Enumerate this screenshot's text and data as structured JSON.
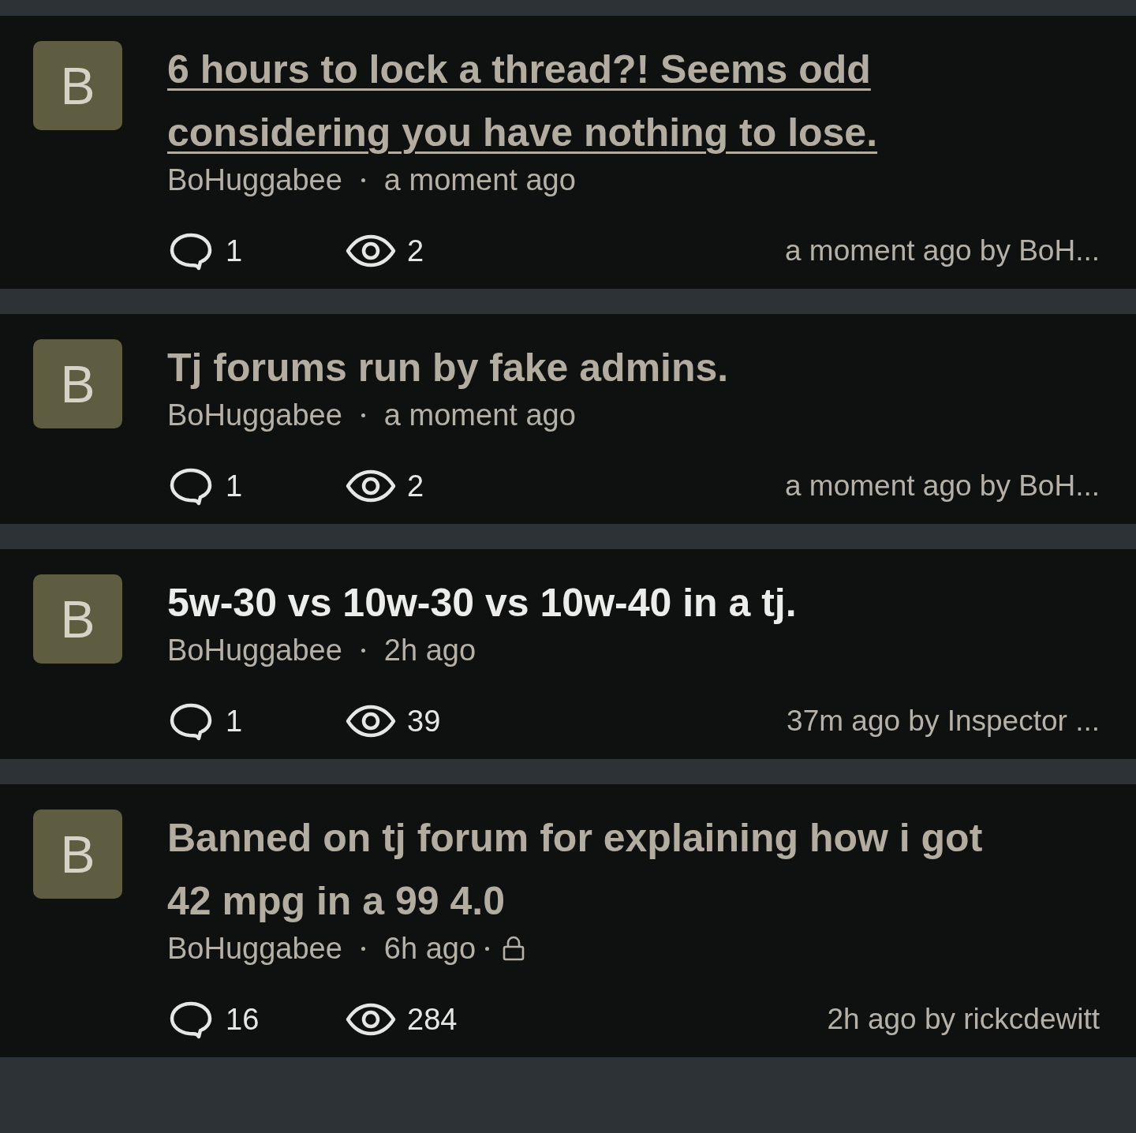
{
  "topics": [
    {
      "avatar": {
        "letter": "B",
        "color": "#5e5d41"
      },
      "title": "6 hours to lock a thread?! Seems odd considering you have nothing to lose.",
      "visited": true,
      "hovered": true,
      "author": "BoHuggabee",
      "time": "a moment ago",
      "locked": false,
      "replies": "1",
      "views": "2",
      "last_activity": "a moment ago by BoH..."
    },
    {
      "avatar": {
        "letter": "B",
        "color": "#5e5d41"
      },
      "title": "Tj forums run by fake admins.",
      "visited": true,
      "hovered": false,
      "author": "BoHuggabee",
      "time": "a moment ago",
      "locked": false,
      "replies": "1",
      "views": "2",
      "last_activity": "a moment ago by BoH..."
    },
    {
      "avatar": {
        "letter": "B",
        "color": "#5e5d41"
      },
      "title": "5w-30 vs 10w-30 vs 10w-40 in a tj.",
      "visited": false,
      "hovered": false,
      "author": "BoHuggabee",
      "time": "2h ago",
      "locked": false,
      "replies": "1",
      "views": "39",
      "last_activity": "37m ago by Inspector ..."
    },
    {
      "avatar": {
        "letter": "B",
        "color": "#5e5d41"
      },
      "title": "Banned on tj forum for explaining how i got 42 mpg in a 99 4.0",
      "visited": true,
      "hovered": false,
      "author": "BoHuggabee",
      "time": "6h ago",
      "locked": true,
      "replies": "16",
      "views": "284",
      "last_activity": "2h ago by rickcdewitt"
    }
  ]
}
